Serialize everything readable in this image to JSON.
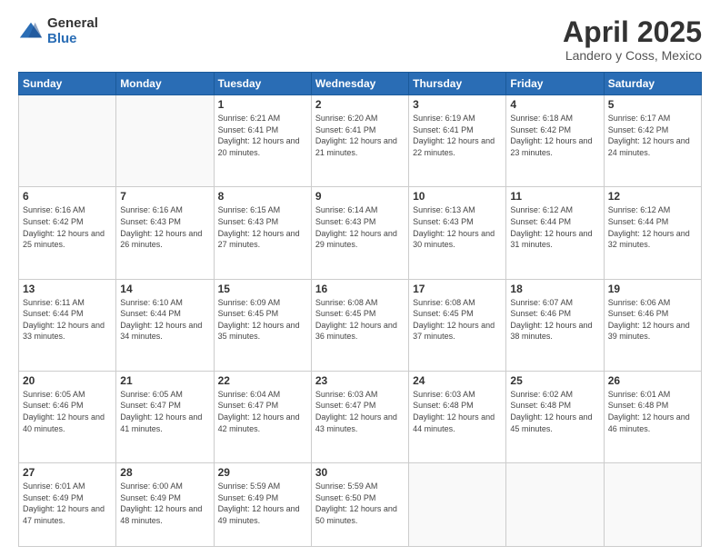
{
  "logo": {
    "general": "General",
    "blue": "Blue"
  },
  "header": {
    "month": "April 2025",
    "location": "Landero y Coss, Mexico"
  },
  "weekdays": [
    "Sunday",
    "Monday",
    "Tuesday",
    "Wednesday",
    "Thursday",
    "Friday",
    "Saturday"
  ],
  "weeks": [
    [
      {
        "day": "",
        "sunrise": "",
        "sunset": "",
        "daylight": ""
      },
      {
        "day": "",
        "sunrise": "",
        "sunset": "",
        "daylight": ""
      },
      {
        "day": "1",
        "sunrise": "Sunrise: 6:21 AM",
        "sunset": "Sunset: 6:41 PM",
        "daylight": "Daylight: 12 hours and 20 minutes."
      },
      {
        "day": "2",
        "sunrise": "Sunrise: 6:20 AM",
        "sunset": "Sunset: 6:41 PM",
        "daylight": "Daylight: 12 hours and 21 minutes."
      },
      {
        "day": "3",
        "sunrise": "Sunrise: 6:19 AM",
        "sunset": "Sunset: 6:41 PM",
        "daylight": "Daylight: 12 hours and 22 minutes."
      },
      {
        "day": "4",
        "sunrise": "Sunrise: 6:18 AM",
        "sunset": "Sunset: 6:42 PM",
        "daylight": "Daylight: 12 hours and 23 minutes."
      },
      {
        "day": "5",
        "sunrise": "Sunrise: 6:17 AM",
        "sunset": "Sunset: 6:42 PM",
        "daylight": "Daylight: 12 hours and 24 minutes."
      }
    ],
    [
      {
        "day": "6",
        "sunrise": "Sunrise: 6:16 AM",
        "sunset": "Sunset: 6:42 PM",
        "daylight": "Daylight: 12 hours and 25 minutes."
      },
      {
        "day": "7",
        "sunrise": "Sunrise: 6:16 AM",
        "sunset": "Sunset: 6:43 PM",
        "daylight": "Daylight: 12 hours and 26 minutes."
      },
      {
        "day": "8",
        "sunrise": "Sunrise: 6:15 AM",
        "sunset": "Sunset: 6:43 PM",
        "daylight": "Daylight: 12 hours and 27 minutes."
      },
      {
        "day": "9",
        "sunrise": "Sunrise: 6:14 AM",
        "sunset": "Sunset: 6:43 PM",
        "daylight": "Daylight: 12 hours and 29 minutes."
      },
      {
        "day": "10",
        "sunrise": "Sunrise: 6:13 AM",
        "sunset": "Sunset: 6:43 PM",
        "daylight": "Daylight: 12 hours and 30 minutes."
      },
      {
        "day": "11",
        "sunrise": "Sunrise: 6:12 AM",
        "sunset": "Sunset: 6:44 PM",
        "daylight": "Daylight: 12 hours and 31 minutes."
      },
      {
        "day": "12",
        "sunrise": "Sunrise: 6:12 AM",
        "sunset": "Sunset: 6:44 PM",
        "daylight": "Daylight: 12 hours and 32 minutes."
      }
    ],
    [
      {
        "day": "13",
        "sunrise": "Sunrise: 6:11 AM",
        "sunset": "Sunset: 6:44 PM",
        "daylight": "Daylight: 12 hours and 33 minutes."
      },
      {
        "day": "14",
        "sunrise": "Sunrise: 6:10 AM",
        "sunset": "Sunset: 6:44 PM",
        "daylight": "Daylight: 12 hours and 34 minutes."
      },
      {
        "day": "15",
        "sunrise": "Sunrise: 6:09 AM",
        "sunset": "Sunset: 6:45 PM",
        "daylight": "Daylight: 12 hours and 35 minutes."
      },
      {
        "day": "16",
        "sunrise": "Sunrise: 6:08 AM",
        "sunset": "Sunset: 6:45 PM",
        "daylight": "Daylight: 12 hours and 36 minutes."
      },
      {
        "day": "17",
        "sunrise": "Sunrise: 6:08 AM",
        "sunset": "Sunset: 6:45 PM",
        "daylight": "Daylight: 12 hours and 37 minutes."
      },
      {
        "day": "18",
        "sunrise": "Sunrise: 6:07 AM",
        "sunset": "Sunset: 6:46 PM",
        "daylight": "Daylight: 12 hours and 38 minutes."
      },
      {
        "day": "19",
        "sunrise": "Sunrise: 6:06 AM",
        "sunset": "Sunset: 6:46 PM",
        "daylight": "Daylight: 12 hours and 39 minutes."
      }
    ],
    [
      {
        "day": "20",
        "sunrise": "Sunrise: 6:05 AM",
        "sunset": "Sunset: 6:46 PM",
        "daylight": "Daylight: 12 hours and 40 minutes."
      },
      {
        "day": "21",
        "sunrise": "Sunrise: 6:05 AM",
        "sunset": "Sunset: 6:47 PM",
        "daylight": "Daylight: 12 hours and 41 minutes."
      },
      {
        "day": "22",
        "sunrise": "Sunrise: 6:04 AM",
        "sunset": "Sunset: 6:47 PM",
        "daylight": "Daylight: 12 hours and 42 minutes."
      },
      {
        "day": "23",
        "sunrise": "Sunrise: 6:03 AM",
        "sunset": "Sunset: 6:47 PM",
        "daylight": "Daylight: 12 hours and 43 minutes."
      },
      {
        "day": "24",
        "sunrise": "Sunrise: 6:03 AM",
        "sunset": "Sunset: 6:48 PM",
        "daylight": "Daylight: 12 hours and 44 minutes."
      },
      {
        "day": "25",
        "sunrise": "Sunrise: 6:02 AM",
        "sunset": "Sunset: 6:48 PM",
        "daylight": "Daylight: 12 hours and 45 minutes."
      },
      {
        "day": "26",
        "sunrise": "Sunrise: 6:01 AM",
        "sunset": "Sunset: 6:48 PM",
        "daylight": "Daylight: 12 hours and 46 minutes."
      }
    ],
    [
      {
        "day": "27",
        "sunrise": "Sunrise: 6:01 AM",
        "sunset": "Sunset: 6:49 PM",
        "daylight": "Daylight: 12 hours and 47 minutes."
      },
      {
        "day": "28",
        "sunrise": "Sunrise: 6:00 AM",
        "sunset": "Sunset: 6:49 PM",
        "daylight": "Daylight: 12 hours and 48 minutes."
      },
      {
        "day": "29",
        "sunrise": "Sunrise: 5:59 AM",
        "sunset": "Sunset: 6:49 PM",
        "daylight": "Daylight: 12 hours and 49 minutes."
      },
      {
        "day": "30",
        "sunrise": "Sunrise: 5:59 AM",
        "sunset": "Sunset: 6:50 PM",
        "daylight": "Daylight: 12 hours and 50 minutes."
      },
      {
        "day": "",
        "sunrise": "",
        "sunset": "",
        "daylight": ""
      },
      {
        "day": "",
        "sunrise": "",
        "sunset": "",
        "daylight": ""
      },
      {
        "day": "",
        "sunrise": "",
        "sunset": "",
        "daylight": ""
      }
    ]
  ]
}
